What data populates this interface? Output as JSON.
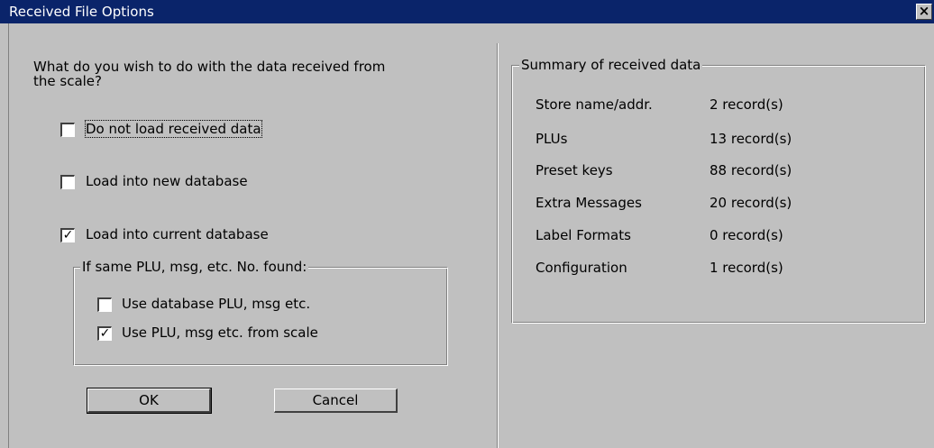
{
  "window": {
    "title": "Received File Options",
    "close_glyph": "×"
  },
  "left": {
    "question": "What do you wish to do with the data received from the scale?",
    "options": [
      {
        "label": "Do not load received data",
        "checked": false
      },
      {
        "label": "Load into new database",
        "checked": false
      },
      {
        "label": "Load into current database",
        "checked": true
      }
    ],
    "group": {
      "legend": "If same PLU, msg, etc. No. found:",
      "options": [
        {
          "label": "Use database PLU, msg etc.",
          "checked": false
        },
        {
          "label": "Use PLU, msg etc. from scale",
          "checked": true
        }
      ]
    },
    "ok_label": "OK",
    "cancel_label": "Cancel"
  },
  "summary": {
    "legend": "Summary of received data",
    "rows": [
      {
        "label": "Store name/addr.",
        "value": "2 record(s)"
      },
      {
        "label": "PLUs",
        "value": "13 record(s)"
      },
      {
        "label": "Preset keys",
        "value": "88 record(s)"
      },
      {
        "label": "Extra Messages",
        "value": "20 record(s)"
      },
      {
        "label": "Label Formats",
        "value": "0 record(s)"
      },
      {
        "label": "Configuration",
        "value": "1 record(s)"
      }
    ]
  },
  "check_glyph": "✓"
}
